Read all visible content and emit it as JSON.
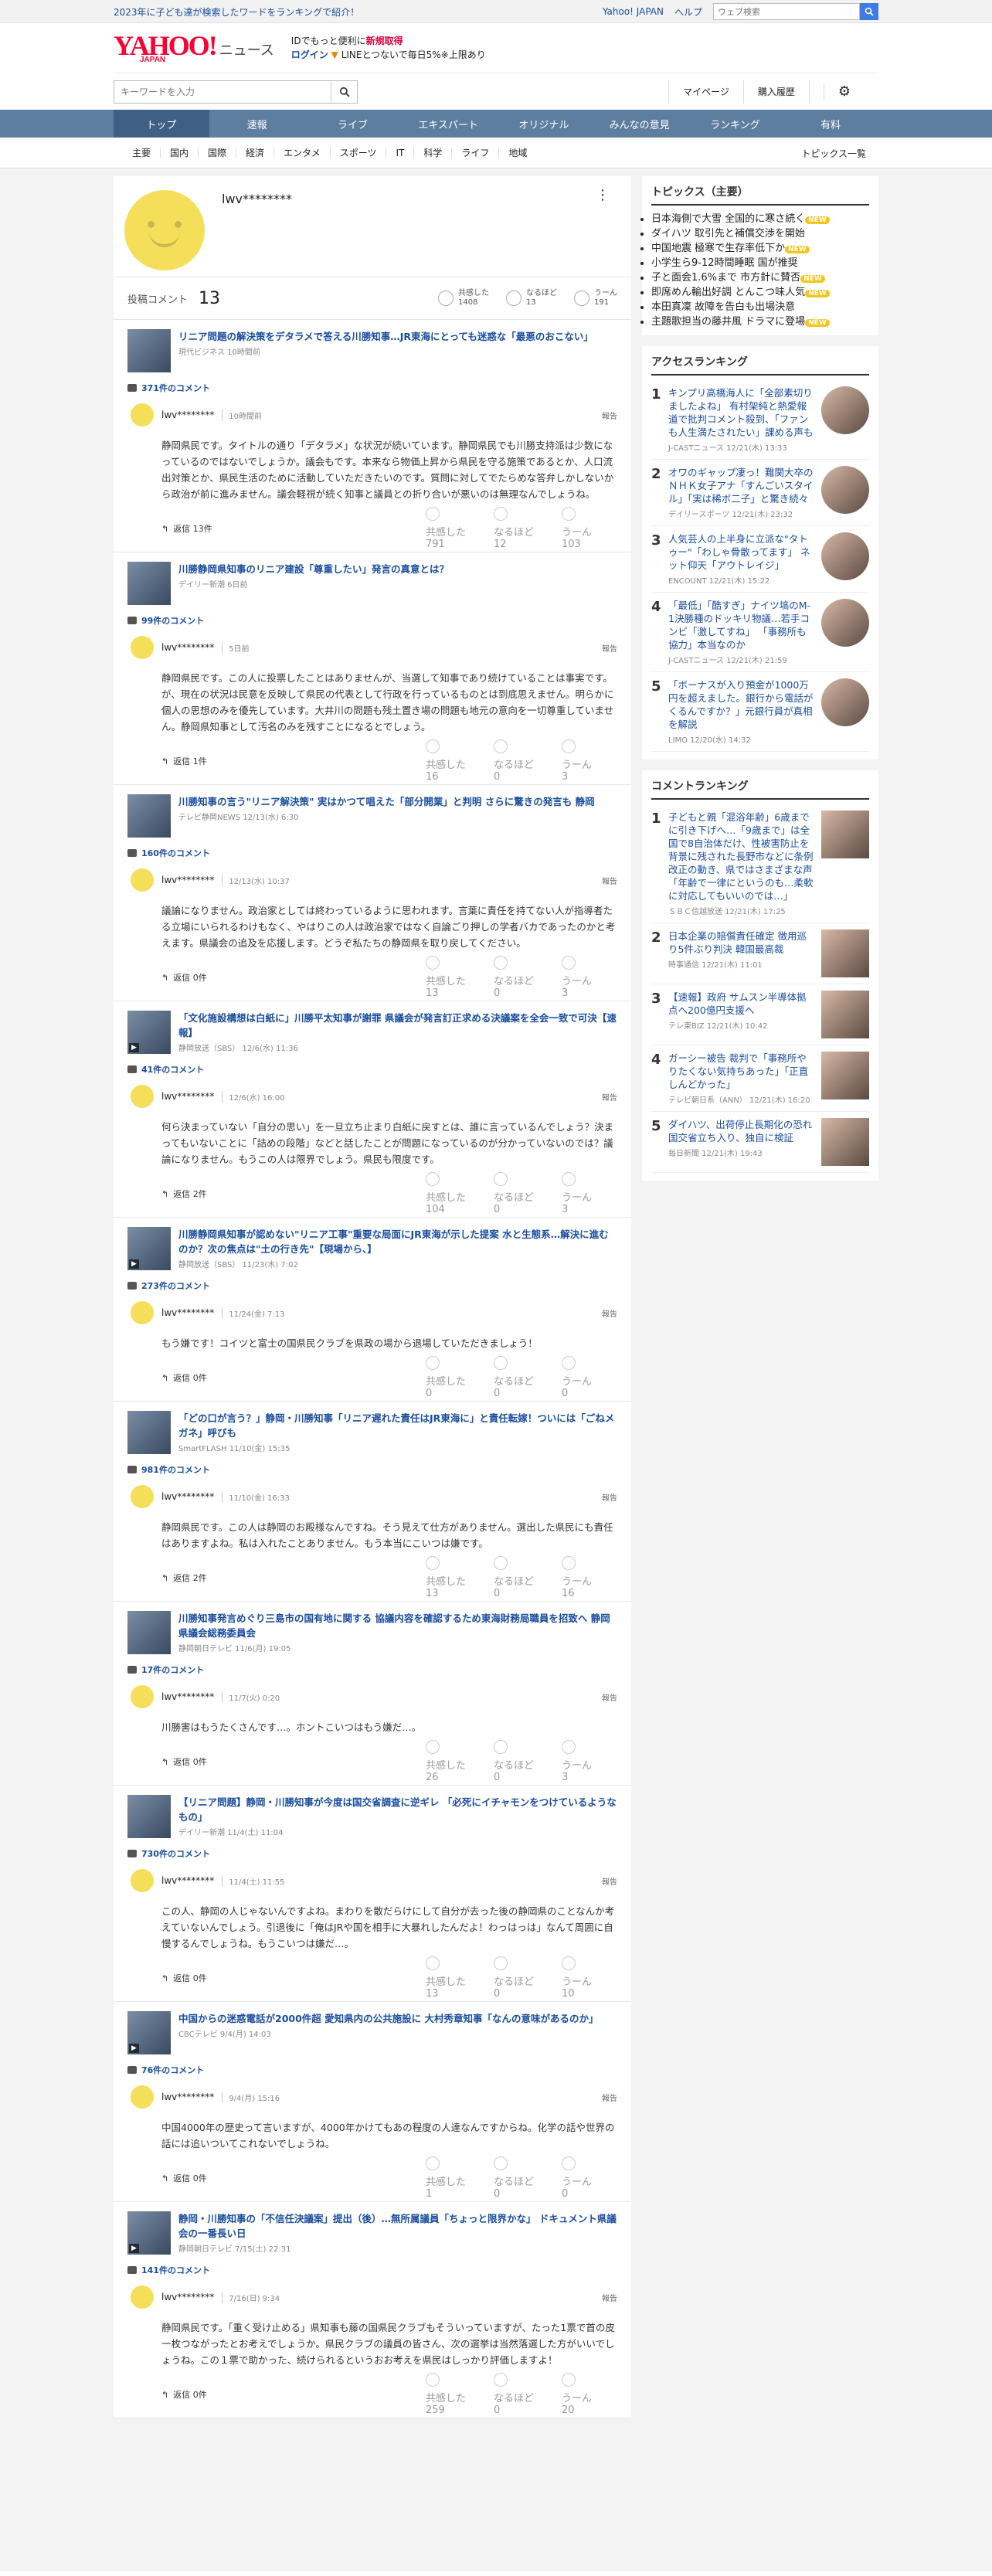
{
  "topbar": {
    "ad": "2023年に子ども達が検索したワードをランキングで紹介！",
    "links": [
      "Yahoo! JAPAN",
      "ヘルプ"
    ],
    "search_placeholder": "ウェブ検索"
  },
  "brand": {
    "logo": "YAHOO!",
    "sub": "JAPAN",
    "service": "ニュース"
  },
  "login": {
    "line1": "IDでもっと便利に",
    "line1b": "新規取得",
    "line2": "ログイン",
    "line2b": "LINEとつないで毎日5%※上限あり"
  },
  "search": {
    "placeholder": "キーワードを入力"
  },
  "header_right": [
    "マイページ",
    "購入履歴"
  ],
  "gnav": [
    "トップ",
    "速報",
    "ライブ",
    "エキスパート",
    "オリジナル",
    "みんなの意見",
    "ランキング",
    "有料"
  ],
  "cnav": [
    "主要",
    "国内",
    "国際",
    "経済",
    "エンタメ",
    "スポーツ",
    "IT",
    "科学",
    "ライフ",
    "地域"
  ],
  "cnav_all": "トピックス一覧",
  "profile": {
    "name": "lwv********",
    "count_label": "投稿コメント",
    "count": "13",
    "reactions": [
      {
        "l": "共感した",
        "v": "1408"
      },
      {
        "l": "なるほど",
        "v": "13"
      },
      {
        "l": "うーん",
        "v": "191"
      }
    ]
  },
  "items": [
    {
      "title": "リニア問題の解決策をデタラメで答える川勝知事…JR東海にとっても迷惑な「最悪のおこない」",
      "src": "現代ビジネス 10時間前",
      "cc": "371件のコメント",
      "user": "lwv********",
      "time": "10時間前",
      "report": "報告",
      "body": "静岡県民です。タイトルの通り「デタラメ」な状況が続いています。静岡県民でも川勝支持派は少数になっているのではないでしょうか。議会もです。本来なら物価上昇から県民を守る施策であるとか、人口流出対策とか、県民生活のために活動していただきたいのです。質問に対してでたらめな答弁しかしないから政治が前に進みません。議会軽視が続く知事と議員との折り合いが悪いのは無理なんでしょうね。",
      "reply": "返信 13件",
      "r": [
        "791",
        "12",
        "103"
      ],
      "v": false
    },
    {
      "title": "川勝静岡県知事のリニア建設「尊重したい」発言の真意とは？",
      "src": "デイリー新潮 6日前",
      "cc": "99件のコメント",
      "user": "lwv********",
      "time": "5日前",
      "report": "報告",
      "body": "静岡県民です。この人に投票したことはありませんが、当選して知事であり続けていることは事実です。が、現在の状況は民意を反映して県民の代表として行政を行っているものとは到底思えません。明らかに個人の思想のみを優先しています。大井川の問題も残土置き場の問題も地元の意向を一切尊重していません。静岡県知事として汚名のみを残すことになるとでしょう。",
      "reply": "返信 1件",
      "r": [
        "16",
        "0",
        "3"
      ],
      "v": false
    },
    {
      "title": "川勝知事の言う\"リニア解決策\" 実はかつて唱えた「部分開業」と判明 さらに驚きの発言も 静岡",
      "src": "テレビ静岡NEWS 12/13(水) 6:30",
      "cc": "160件のコメント",
      "user": "lwv********",
      "time": "12/13(水) 10:37",
      "report": "報告",
      "body": "議論になりません。政治家としては終わっているように思われます。言葉に責任を持てない人が指導者たる立場にいられるわけもなく、やはりこの人は政治家ではなく自論ごり押しの学者バカであったのかと考えます。県議会の追及を応援します。どうぞ私たちの静岡県を取り戻してください。",
      "reply": "返信 0件",
      "r": [
        "13",
        "0",
        "3"
      ],
      "v": false
    },
    {
      "title": "「文化施設構想は白紙に」川勝平太知事が謝罪 県議会が発言訂正求める決議案を全会一致で可決【速報】",
      "src": "静岡放送（SBS） 12/6(水) 11:36",
      "cc": "41件のコメント",
      "user": "lwv********",
      "time": "12/6(水) 16:00",
      "report": "報告",
      "body": "何ら決まっていない「自分の思い」を一旦立ち止まり白紙に戻すとは、誰に言っているんでしょう？決まってもいないことに「詰めの段階」などと話したことが問題になっているのが分かっていないのでは？議論になりません。もうこの人は限界でしょう。県民も限度です。",
      "reply": "返信 2件",
      "r": [
        "104",
        "0",
        "3"
      ],
      "v": true
    },
    {
      "title": "川勝静岡県知事が認めない\"リニア工事\"重要な局面にJR東海が示した提案 水と生態系…解決に進むのか？次の焦点は\"土の行き先\"【現場から、】",
      "src": "静岡放送（SBS） 11/23(木) 7:02",
      "cc": "273件のコメント",
      "user": "lwv********",
      "time": "11/24(金) 7:13",
      "report": "報告",
      "body": "もう嫌です！コイツと富士の国県民クラブを県政の場から退場していただきましょう！",
      "reply": "返信 0件",
      "r": [
        "0",
        "0",
        "0"
      ],
      "v": true
    },
    {
      "title": "「どの口が言う？」静岡・川勝知事「リニア遅れた責任はJR東海に」と責任転嫁！ついには「ごねメガネ」呼びも",
      "src": "SmartFLASH 11/10(金) 15:35",
      "cc": "981件のコメント",
      "user": "lwv********",
      "time": "11/10(金) 16:33",
      "report": "報告",
      "body": "静岡県民です。この人は静岡のお殿様なんですね。そう見えて仕方がありません。選出した県民にも責任はありますよね。私は入れたことありません。もう本当にこいつは嫌です。",
      "reply": "返信 2件",
      "r": [
        "13",
        "0",
        "16"
      ],
      "v": false
    },
    {
      "title": "川勝知事発言めぐり三島市の国有地に関する 協議内容を確認するため東海財務局職員を招致へ 静岡県議会総務委員会",
      "src": "静岡朝日テレビ 11/6(月) 19:05",
      "cc": "17件のコメント",
      "user": "lwv********",
      "time": "11/7(火) 0:20",
      "report": "報告",
      "body": "川勝害はもうたくさんです…。ホントこいつはもう嫌だ…。",
      "reply": "返信 0件",
      "r": [
        "26",
        "0",
        "3"
      ],
      "v": false
    },
    {
      "title": "【リニア問題】静岡・川勝知事が今度は国交省調査に逆ギレ 「必死にイチャモンをつけているようなもの」",
      "src": "デイリー新潮 11/4(土) 11:04",
      "cc": "730件のコメント",
      "user": "lwv********",
      "time": "11/4(土) 11:55",
      "report": "報告",
      "body": "この人、静岡の人じゃないんですよね。まわりを散だらけにして自分が去った後の静岡県のことなんか考えていないんでしょう。引退後に「俺はJRや国を相手に大暴れしたんだよ！わっはっは」なんて周囲に自慢するんでしょうね。もうこいつは嫌だ…。",
      "reply": "返信 0件",
      "r": [
        "13",
        "0",
        "10"
      ],
      "v": false
    },
    {
      "title": "中国からの迷惑電話が2000件超 愛知県内の公共施設に 大村秀章知事「なんの意味があるのか」",
      "src": "CBCテレビ 9/4(月) 14:03",
      "cc": "76件のコメント",
      "user": "lwv********",
      "time": "9/4(月) 15:16",
      "report": "報告",
      "body": "中国4000年の歴史って言いますが、4000年かけてもあの程度の人達なんですからね。化学の話や世界の話には追いついてこれないでしょうね。",
      "reply": "返信 0件",
      "r": [
        "1",
        "0",
        "0"
      ],
      "v": true
    },
    {
      "title": "静岡・川勝知事の「不信任決議案」提出（後）…無所属議員「ちょっと限界かな」 ドキュメント県議会の一番長い日",
      "src": "静岡朝日テレビ 7/15(土) 22:31",
      "cc": "141件のコメント",
      "user": "lwv********",
      "time": "7/16(日) 9:34",
      "report": "報告",
      "body": "静岡県民です。「重く受け止める」県知事も藤の国県民クラブもそういっていますが、たった1票で首の皮一枚つながったとお考えでしょうか。県民クラブの議員の皆さん、次の選挙は当然落選した方がいいでしょうね。この１票で助かった、続けられるというおお考えを県民はしっかり評価しますよ！",
      "reply": "返信 0件",
      "r": [
        "259",
        "0",
        "20"
      ],
      "v": true
    }
  ],
  "topics": {
    "title": "トピックス（主要）",
    "items": [
      {
        "t": "日本海側で大雪 全国的に寒さ続く",
        "n": true
      },
      {
        "t": "ダイハツ 取引先と補償交渉を開始",
        "n": false
      },
      {
        "t": "中国地震 極寒で生存率低下か",
        "n": true
      },
      {
        "t": "小学生ら9-12時間睡眠 国が推奨",
        "n": false
      },
      {
        "t": "子と面会1.6%まで 市方針に賛否",
        "n": true
      },
      {
        "t": "即席めん輸出好調 とんこつ味人気",
        "n": true
      },
      {
        "t": "本田真凜 故障を告白も出場決意",
        "n": false
      },
      {
        "t": "主題歌担当の藤井風 ドラマに登場",
        "n": true
      }
    ],
    "new_label": "NEW"
  },
  "access": {
    "title": "アクセスランキング",
    "items": [
      {
        "n": "1",
        "t": "キンプリ高橋海人に「全部素切りましたよね」 有村架純と熱愛報道で批判コメント殺到、「ファンも人生満たされたい」課める声も",
        "s": "J-CASTニュース 12/21(木) 13:33"
      },
      {
        "n": "2",
        "t": "オワのギャップ凄っ！難関大卒のＮＨＫ女子アナ「すんごいスタイル」「実は稀ボ二子」と驚き続々",
        "s": "デイリースポーツ 12/21(木) 23:32"
      },
      {
        "n": "3",
        "t": "人気芸人の上半身に立派な\"タトゥー\"「わしゃ骨散ってます」 ネット仰天「アウトレイジ」",
        "s": "ENCOUNT 12/21(木) 15:22"
      },
      {
        "n": "4",
        "t": "「最低」「酷すぎ」ナイツ塙のM-1決勝種のドッキリ物議…若手コンビ「激してすね」 「事務所も協力」本当なのか",
        "s": "J-CASTニュース 12/21(木) 21:59"
      },
      {
        "n": "5",
        "t": "「ボーナスが入り預金が1000万円を超えました。銀行から電話がくるんですか？」元銀行員が真相を解説",
        "s": "LIMO 12/20(水) 14:32"
      }
    ]
  },
  "comment_rank": {
    "title": "コメントランキング",
    "items": [
      {
        "n": "1",
        "t": "子どもと親「混浴年齢」6歳までに引き下げへ…「9歳まで」は全国で8自治体だけ、性被害防止を背景に残された長野市などに条例改正の動き、県ではさまざまな声「年齢で一律にというのも…柔軟に対応してもいいのでは…」",
        "s": "ＳＢＣ信越放送 12/21(木) 17:25"
      },
      {
        "n": "2",
        "t": "日本企業の賠償責任確定 徴用巡り5件ぶり判決 韓国最高裁",
        "s": "時事通信 12/21(木) 11:01"
      },
      {
        "n": "3",
        "t": "【速報】政府 サムスン半導体拠点へ200億円支援へ",
        "s": "テレ東BIZ 12/21(木) 10:42"
      },
      {
        "n": "4",
        "t": "ガーシー被告 裁判で「事務所やりたくない気持ちあった」「正直しんどかった」",
        "s": "テレビ朝日系（ANN） 12/21(木) 16:20"
      },
      {
        "n": "5",
        "t": "ダイハツ、出荷停止長期化の恐れ 国交省立ち入り、独自に検証",
        "s": "毎日新聞 12/21(木) 19:43"
      }
    ]
  },
  "reaction_labels": [
    "共感した",
    "なるほど",
    "うーん"
  ]
}
